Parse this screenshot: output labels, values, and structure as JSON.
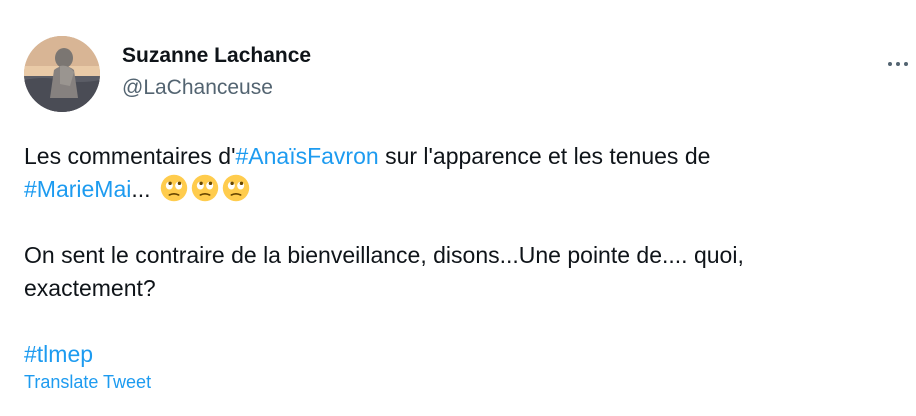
{
  "author": {
    "display_name": "Suzanne Lachance",
    "handle": "@LaChanceuse",
    "avatar_icon": "profile-photo"
  },
  "more_icon": "more-horizontal-icon",
  "tweet": {
    "line1_prefix": "Les commentaires d'",
    "hashtag1": "#AnaïsFavron",
    "line1_suffix": " sur l'apparence et les tenues de",
    "hashtag2": "#MarieMai",
    "line2_suffix": "...",
    "emoji_name": "face-with-rolling-eyes",
    "paragraph2_line1": "On sent le contraire de la bienveillance, disons...Une pointe de.... quoi,",
    "paragraph2_line2": "exactement?",
    "hashtag3": "#tlmep"
  },
  "translate_label": "Translate Tweet",
  "colors": {
    "link": "#1d9bf0",
    "text": "#0f1419",
    "muted": "#536471"
  }
}
